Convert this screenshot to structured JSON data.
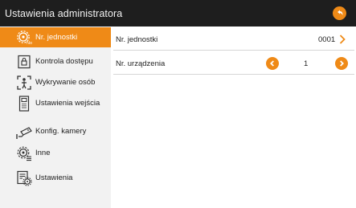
{
  "header": {
    "title": "Ustawienia administratora"
  },
  "sidebar": {
    "items": [
      {
        "label": "Nr. jednostki",
        "icon": "unit-number-gear-icon",
        "active": true
      },
      {
        "label": "Kontrola dostępu",
        "icon": "door-lock-icon",
        "active": false
      },
      {
        "label": "Wykrywanie osób",
        "icon": "person-detection-icon",
        "active": false
      },
      {
        "label": "Ustawienia wejścia",
        "icon": "intercom-panel-icon",
        "active": false
      },
      {
        "label": "Konfig. kamery",
        "icon": "camera-icon",
        "active": false
      },
      {
        "label": "Inne",
        "icon": "settings-list-icon",
        "active": false
      },
      {
        "label": "Ustawienia",
        "icon": "settings-document-icon",
        "active": false
      }
    ]
  },
  "main": {
    "unit_number": {
      "label": "Nr. jednostki",
      "value": "0001"
    },
    "device_number": {
      "label": "Nr. urządzenia",
      "value": "1"
    }
  },
  "colors": {
    "accent": "#ef8a17",
    "header_bg": "#1e1e1e",
    "sidebar_bg": "#f2f2f2"
  }
}
